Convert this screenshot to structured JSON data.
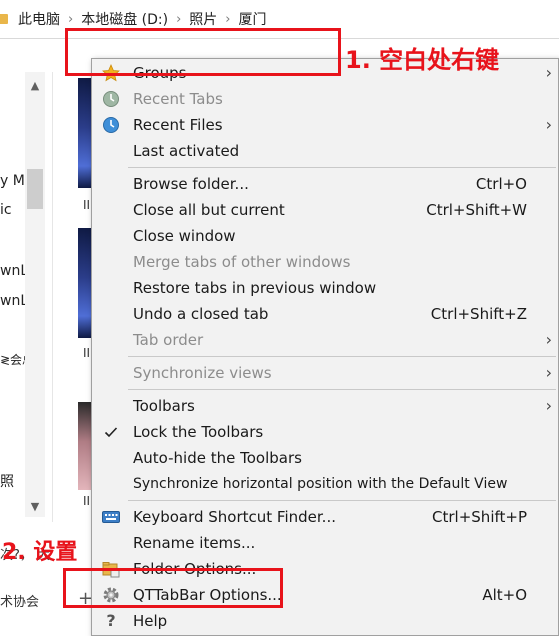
{
  "breadcrumb": [
    "此电脑",
    "本地磁盘 (D:)",
    "照片",
    "厦门"
  ],
  "left_pane_texts": [
    "y M",
    "ic",
    "wnL",
    "wnL",
    "≷会总",
    "照"
  ],
  "thumb_labels": [
    "II",
    "II",
    "II"
  ],
  "bottom_texts": [
    "次?， 大",
    "术协会"
  ],
  "context_menu": {
    "groups": [
      [
        {
          "label": "Groups",
          "icon": "star-icon",
          "submenu": true,
          "disabled": false
        },
        {
          "label": "Recent Tabs",
          "icon": "recent-tabs-icon",
          "submenu": false,
          "disabled": true
        },
        {
          "label": "Recent Files",
          "icon": "recent-files-icon",
          "submenu": true,
          "disabled": false
        },
        {
          "label": "Last activated",
          "icon": "",
          "submenu": false,
          "disabled": false
        }
      ],
      [
        {
          "label": "Browse folder...",
          "shortcut": "Ctrl+O",
          "disabled": false
        },
        {
          "label": "Close all but current",
          "shortcut": "Ctrl+Shift+W",
          "disabled": false
        },
        {
          "label": "Close window",
          "shortcut": "",
          "disabled": false
        },
        {
          "label": "Merge tabs of other windows",
          "shortcut": "",
          "disabled": true
        },
        {
          "label": "Restore tabs in previous window",
          "shortcut": "",
          "disabled": false
        },
        {
          "label": "Undo a closed tab",
          "shortcut": "Ctrl+Shift+Z",
          "disabled": false
        },
        {
          "label": "Tab order",
          "shortcut": "",
          "submenu": true,
          "disabled": true
        }
      ],
      [
        {
          "label": "Synchronize views",
          "submenu": true,
          "disabled": true
        }
      ],
      [
        {
          "label": "Toolbars",
          "submenu": true,
          "disabled": false
        },
        {
          "label": "Lock the Toolbars",
          "checked": true,
          "disabled": false
        },
        {
          "label": "Auto-hide the Toolbars",
          "disabled": false
        },
        {
          "label": "Synchronize horizontal position with the Default View",
          "disabled": false
        }
      ],
      [
        {
          "label": "Keyboard Shortcut Finder...",
          "shortcut": "Ctrl+Shift+P",
          "icon": "keyboard-icon",
          "disabled": false
        },
        {
          "label": "Rename items...",
          "disabled": false
        },
        {
          "label": "Folder Options...",
          "icon": "folder-options-icon",
          "disabled": false
        },
        {
          "label": "QTTabBar Options...",
          "shortcut": "Alt+O",
          "icon": "gear-icon",
          "disabled": false
        },
        {
          "label": "Help",
          "icon": "help-icon",
          "disabled": false
        }
      ]
    ]
  },
  "annotations": {
    "step1": "1. 空白处右键",
    "step2": "2. 设置"
  },
  "colors": {
    "annotation_red": "#e8131b",
    "menu_bg": "#f2f2f2",
    "disabled_text": "#8c8c8c"
  }
}
